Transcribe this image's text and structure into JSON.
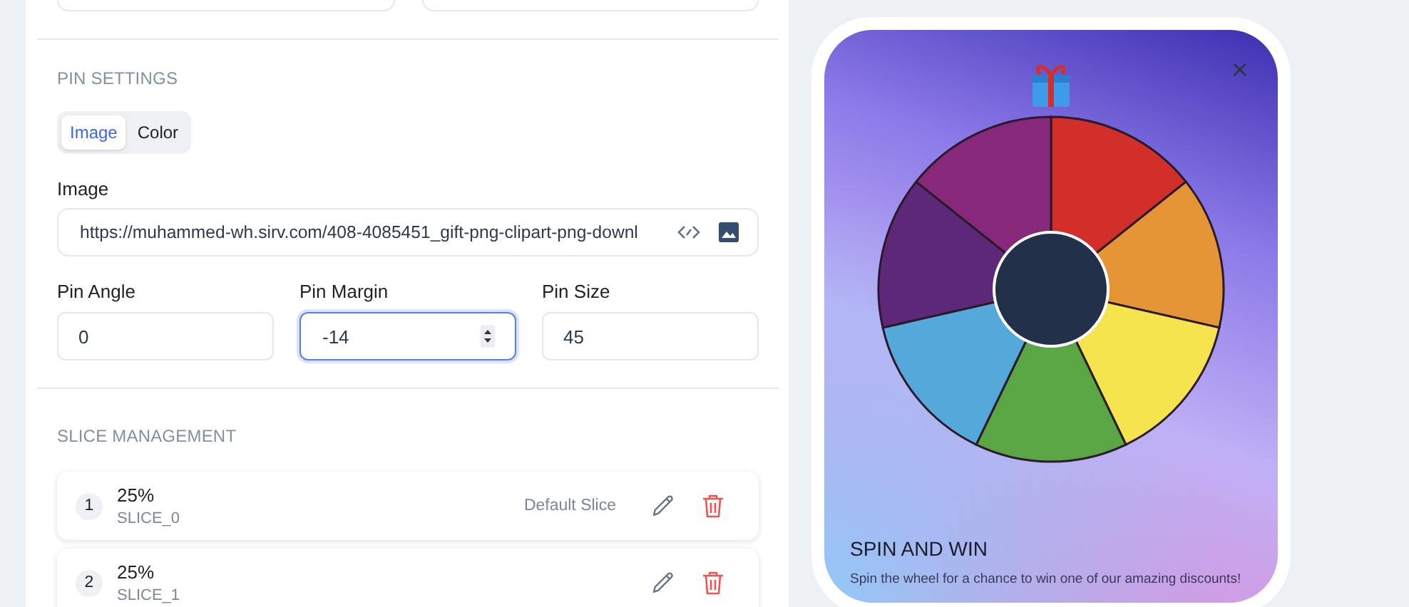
{
  "pin_settings": {
    "heading": "PIN SETTINGS",
    "mode_tabs": [
      {
        "label": "Image",
        "selected": true
      },
      {
        "label": "Color",
        "selected": false
      }
    ],
    "image": {
      "label": "Image",
      "value": "https://muhammed-wh.sirv.com/408-4085451_gift-png-clipart-png-downl"
    },
    "fields": [
      {
        "label": "Pin Angle",
        "value": "0",
        "focused": false
      },
      {
        "label": "Pin Margin",
        "value": "-14",
        "focused": true
      },
      {
        "label": "Pin Size",
        "value": "45",
        "focused": false
      }
    ]
  },
  "slice_management": {
    "heading": "SLICE MANAGEMENT",
    "slices": [
      {
        "number": "1",
        "percent": "25%",
        "name": "SLICE_0",
        "tag": "Default Slice"
      },
      {
        "number": "2",
        "percent": "25%",
        "name": "SLICE_1"
      }
    ]
  },
  "preview": {
    "close": "×",
    "title": "SPIN AND WIN",
    "description": "Spin the wheel for a chance to win one of our amazing discounts!",
    "wheel": [
      {
        "color": "#d32f2a"
      },
      {
        "color": "#e59436"
      },
      {
        "color": "#f6e44e"
      },
      {
        "color": "#5aa645"
      },
      {
        "color": "#55a8da"
      },
      {
        "color": "#5e2878"
      },
      {
        "color": "#88287a"
      }
    ]
  }
}
